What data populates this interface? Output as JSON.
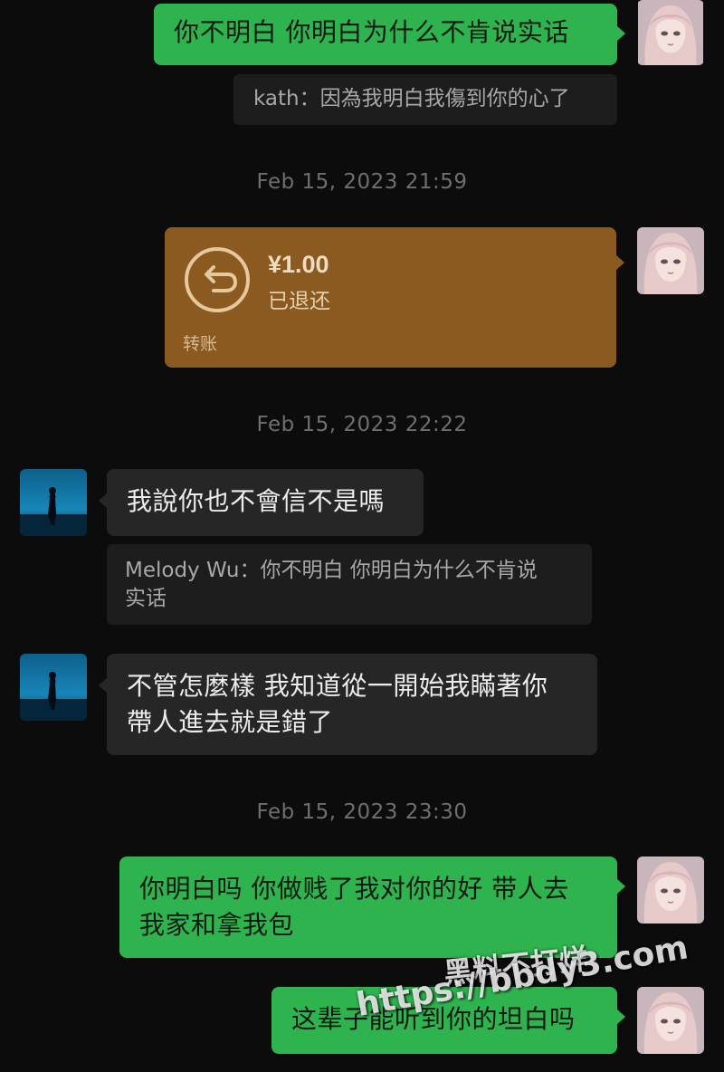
{
  "messages": [
    {
      "text": "你不明白 你明白为什么不肯说实话"
    },
    {
      "quote": "kath：因為我明白我傷到你的心了"
    },
    {
      "timestamp": "Feb 15, 2023 21:59"
    },
    {
      "transfer": {
        "amount": "¥1.00",
        "status": "已退还",
        "label": "转账"
      }
    },
    {
      "timestamp": "Feb 15, 2023 22:22"
    },
    {
      "text": "我說你也不會信不是嗎"
    },
    {
      "quote_line1": "Melody Wu：你不明白 你明白为什么不肯说",
      "quote_line2": "实话"
    },
    {
      "text_line1": "不管怎麼樣 我知道從一開始我瞞著你",
      "text_line2": "帶人進去就是錯了"
    },
    {
      "timestamp": "Feb 15, 2023 23:30"
    },
    {
      "text_line1": "你明白吗 你做贱了我对你的好 带人去",
      "text_line2": "我家和拿我包"
    },
    {
      "text": "这辈子能听到你的坦白吗"
    }
  ],
  "watermark": {
    "line1": "黑料不打烊",
    "line2": "https://bbdy3.com"
  },
  "colors": {
    "background": "#0c0c0c",
    "outgoing_bubble": "#2fb34f",
    "incoming_bubble": "#262626",
    "transfer_card": "#8a5a20",
    "timestamp_text": "#6f6f6f"
  },
  "icons": {
    "transfer_status": "return-arrow-icon"
  }
}
